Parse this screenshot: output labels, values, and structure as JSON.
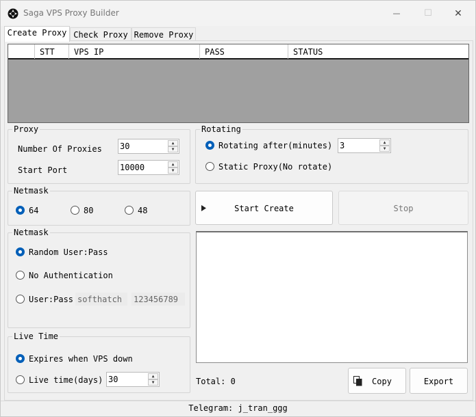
{
  "window": {
    "title": "Saga VPS Proxy Builder",
    "minimize_glyph": "—",
    "maximize_glyph": "☐",
    "close_glyph": "✕"
  },
  "tabs": [
    {
      "label": "Create Proxy",
      "active": true
    },
    {
      "label": "Check Proxy",
      "active": false
    },
    {
      "label": "Remove Proxy",
      "active": false
    }
  ],
  "grid": {
    "columns": [
      "",
      "STT",
      "VPS IP",
      "PASS",
      "STATUS"
    ],
    "rows": []
  },
  "proxy_group": {
    "label": "Proxy",
    "count_label": "Number Of Proxies",
    "count_value": "30",
    "port_label": "Start Port",
    "port_value": "10000"
  },
  "rotating_group": {
    "label": "Rotating",
    "rotate_label": "Rotating after(minutes)",
    "rotate_value": "3",
    "static_label": "Static Proxy(No rotate)",
    "selected": "rotate"
  },
  "netmask_group": {
    "label": "Netmask",
    "options": [
      "64",
      "80",
      "48"
    ],
    "selected": "64"
  },
  "auth_group": {
    "label": "Netmask",
    "random_label": "Random User:Pass",
    "none_label": "No Authentication",
    "userpass_label": "User:Pass",
    "username_value": "softhatch",
    "password_value": "123456789",
    "selected": "random"
  },
  "livetime_group": {
    "label": "Live Time",
    "expires_label": "Expires when VPS down",
    "days_label": "Live time(days)",
    "days_value": "30",
    "selected": "expires"
  },
  "actions": {
    "start_label": "Start Create",
    "stop_label": "Stop",
    "copy_label": "Copy",
    "export_label": "Export"
  },
  "log": {
    "text": ""
  },
  "total": {
    "label": "Total: 0"
  },
  "statusbar": {
    "text": "Telegram: j_tran_ggg"
  },
  "colors": {
    "accent": "#005fb8",
    "grid_background": "#a0a0a0"
  },
  "icons": {
    "app": "saga-logo-icon",
    "play": "play-triangle-icon",
    "copy": "copy-documents-icon"
  }
}
